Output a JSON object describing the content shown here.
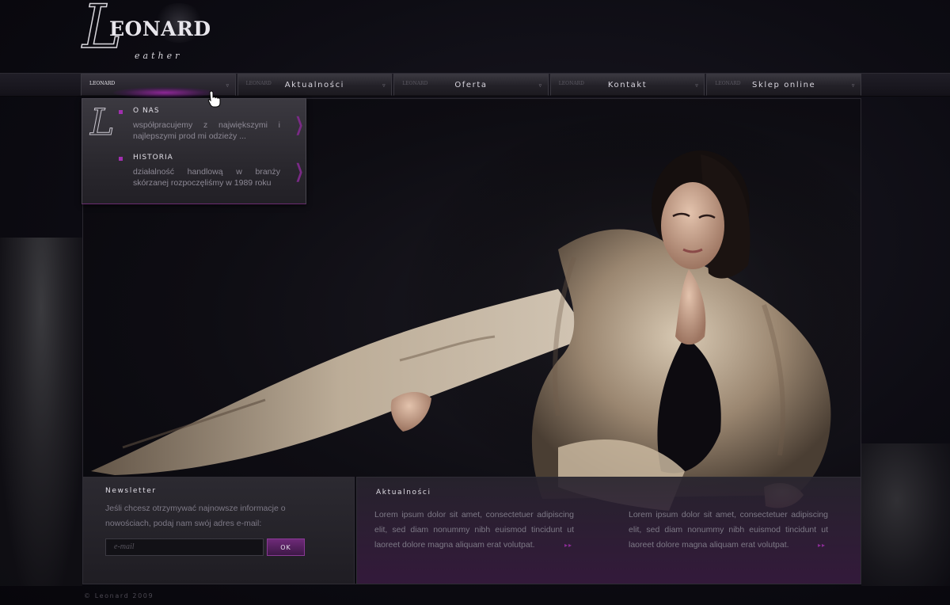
{
  "brand": {
    "big_letter": "L",
    "word": "EONARD",
    "sub": "eather"
  },
  "nav": {
    "home_mini": "LEONARD",
    "items": [
      {
        "label": ""
      },
      {
        "label": "Aktualności",
        "mini": "LEONARD"
      },
      {
        "label": "Oferta",
        "mini": "LEONARD"
      },
      {
        "label": "Kontakt",
        "mini": "LEONARD"
      },
      {
        "label": "Sklep online",
        "mini": "LEONARD"
      }
    ],
    "chevron": "▿"
  },
  "dropdown": {
    "entries": [
      {
        "title": "O NAS",
        "text": "współpracujemy z największymi i najlepszymi prod mi odzieży ..."
      },
      {
        "title": "HISTORIA",
        "text": "działalność handlową w branży skórzanej rozpoczęliśmy w 1989 roku"
      }
    ],
    "arrow": "❯"
  },
  "newsletter": {
    "title": "Newsletter",
    "text": "Jeśli chcesz otrzymywać najnowsze informacje o nowościach, podaj nam swój adres e-mail:",
    "email_placeholder": "e-mail",
    "ok": "OK"
  },
  "news": {
    "title": "Aktualności",
    "items": [
      {
        "text": "Lorem ipsum dolor sit amet, consectetuer adipiscing elit, sed diam nonummy nibh euismod tincidunt ut laoreet dolore magna aliquam erat volutpat.",
        "more": "▸▸"
      },
      {
        "text": "Lorem ipsum dolor sit amet, consectetuer adipiscing elit, sed diam nonummy nibh euismod tincidunt ut laoreet dolore magna aliquam erat volutpat.",
        "more": "▸▸"
      }
    ]
  },
  "footer": {
    "text": "© Leonard 2009"
  },
  "colors": {
    "accent": "#a02fae",
    "background": "#0b0a10",
    "panel": "#2c2a31"
  }
}
